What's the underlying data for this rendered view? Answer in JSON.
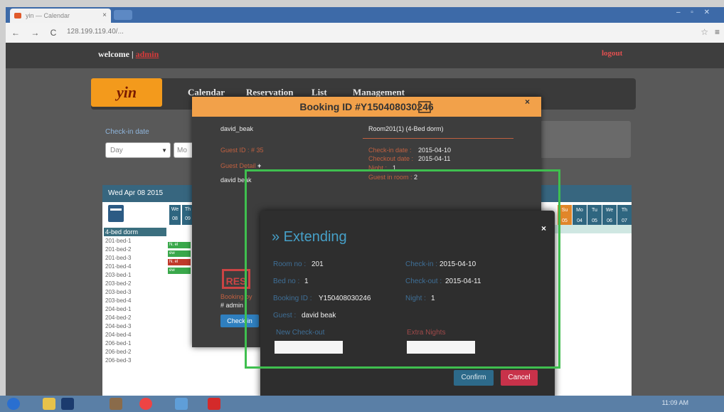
{
  "browser": {
    "tab_title": "yin — Calendar",
    "tab_close": "×",
    "window_controls": "– ▫ ✕",
    "nav_icons": "← → C",
    "url": "128.199.119.40/...",
    "star_icon": "☆",
    "menu_icon": "≡"
  },
  "topbar": {
    "welcome_text": "welcome | ",
    "admin_label": "admin",
    "logout_label": "logout"
  },
  "header": {
    "logo_text": "yin",
    "nav": [
      "Calendar",
      "Reservation",
      "List",
      "Management"
    ]
  },
  "checkin_panel": {
    "label": "Check-in date",
    "day_value": "Day",
    "month_value": "Mo"
  },
  "calendar": {
    "date_title": "Wed Apr 08 2015",
    "left_days": [
      [
        "We",
        "08"
      ],
      [
        "Th",
        "09"
      ]
    ],
    "right_days": [
      [
        "Su",
        "05"
      ],
      [
        "Mo",
        "04"
      ],
      [
        "Tu",
        "05"
      ],
      [
        "We",
        "06"
      ],
      [
        "Th",
        "07"
      ]
    ],
    "group_label": "4-bed dorm",
    "rooms": [
      "201-bed-1",
      "201-bed-2",
      "201-bed-3",
      "201-bed-4",
      "203-bed-1",
      "203-bed-2",
      "203-bed-3",
      "203-bed-4",
      "204-bed-1",
      "204-bed-2",
      "204-bed-3",
      "204-bed-4",
      "206-bed-1",
      "206-bed-2",
      "206-bed-3"
    ],
    "bookings": [
      "N. el",
      "ew",
      "N. el",
      "ew"
    ]
  },
  "booking_modal": {
    "title": "Booking ID #Y150408030246",
    "close": "×",
    "guest_name": "david_beak",
    "room": "Room201(1) (4-Bed dorm)",
    "guest_id": "Guest ID : # 35",
    "guest_detail": "Guest Detail",
    "guest_detail_plus": "+",
    "guest_detail_name": "david beak",
    "checkin_label": "Check-in date :",
    "checkin_value": "2015-04-10",
    "checkout_label": "Checkout date :",
    "checkout_value": "2015-04-11",
    "night_label": "Night :",
    "night_value": "1",
    "guests_label": "Guest in room :",
    "guests_value": "2",
    "stamp_text": "RES",
    "booking_by_label": "Booking by",
    "booking_by_value": "# admin",
    "checkin_button": "Check-in"
  },
  "extend_modal": {
    "title": "» Extending",
    "close": "×",
    "room_label": "Room no :",
    "room_value": "201",
    "checkin_label": "Check-in :",
    "checkin_value": "2015-04-10",
    "bed_label": "Bed no :",
    "bed_value": "1",
    "checkout_label": "Check-out :",
    "checkout_value": "2015-04-11",
    "booking_label": "Booking ID :",
    "booking_value": "Y150408030246",
    "night_label": "Night :",
    "night_value": "1",
    "guest_label": "Guest :",
    "guest_value": "david beak",
    "new_checkout_label": "New Check-out",
    "extra_nights_label": "Extra Nights",
    "confirm_label": "Confirm",
    "cancel_label": "Cancel"
  },
  "taskbar": {
    "clock": "11:09 AM"
  },
  "colors": {
    "accent_orange": "#f2a14a",
    "extend_title": "#46a0c8",
    "cancel_red": "#c8324a",
    "highlight_green": "#3fbf4f"
  }
}
